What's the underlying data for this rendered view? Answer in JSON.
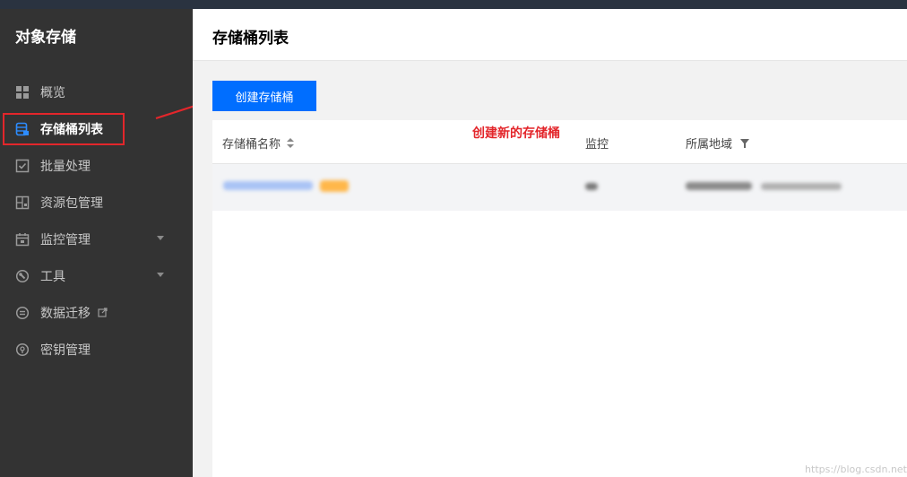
{
  "sidebar": {
    "brand": "对象存储",
    "items": [
      {
        "label": "概览",
        "icon": "overview-grid-icon"
      },
      {
        "label": "存储桶列表",
        "icon": "bucket-list-icon"
      },
      {
        "label": "批量处理",
        "icon": "batch-check-icon"
      },
      {
        "label": "资源包管理",
        "icon": "package-icon"
      },
      {
        "label": "监控管理",
        "icon": "calendar-icon"
      },
      {
        "label": "工具",
        "icon": "tool-icon"
      },
      {
        "label": "数据迁移",
        "icon": "migrate-icon"
      },
      {
        "label": "密钥管理",
        "icon": "key-icon"
      }
    ],
    "active_label": "存储桶列表"
  },
  "header": {
    "title": "存储桶列表"
  },
  "toolbar": {
    "create_label": "创建存储桶"
  },
  "annotation": {
    "text": "创建新的存储桶"
  },
  "table": {
    "columns": [
      "存储桶名称",
      "监控",
      "所属地域"
    ]
  },
  "watermark": "https://blog.csdn.net",
  "colors": {
    "accent": "#006eff",
    "sidebar_bg": "#333333",
    "annotation_red": "#e3262b"
  }
}
